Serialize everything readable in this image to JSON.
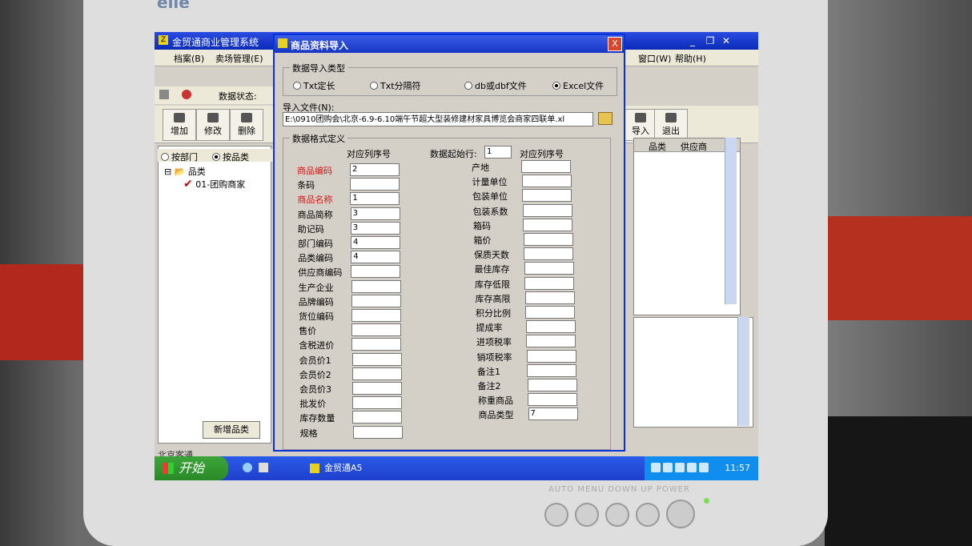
{
  "brand": "elle",
  "app": {
    "title": "金贸通商业管理系统",
    "menu": [
      "档案(B)",
      "卖场管理(E)",
      "窗口(W)",
      "帮助(H)"
    ],
    "status_label": "数据状态:",
    "toolbar": {
      "add": "增加",
      "edit": "修改",
      "delete": "删除",
      "import": "导入",
      "exit": "退出"
    },
    "filter": {
      "by_dept": "按部门",
      "by_category": "按品类"
    },
    "tree": {
      "root": "品类",
      "child": "01-团购商家"
    },
    "new_category_button": "新增品类",
    "grid_headers": [
      "品类",
      "供应商"
    ],
    "bottom_text": "北京客通"
  },
  "dialog": {
    "title": "商品资料导入",
    "close": "X",
    "type_group_title": "数据导入类型",
    "types": [
      {
        "label": "Txt定长",
        "selected": false
      },
      {
        "label": "Txt分隔符",
        "selected": false
      },
      {
        "label": "db或dbf文件",
        "selected": false
      },
      {
        "label": "Excel文件",
        "selected": true
      }
    ],
    "file_label": "导入文件(N):",
    "file_path": "E:\\0910团购会\\北京-6.9-6.10端午节超大型装修建材家具博览会商家四联单.xl",
    "format_group_title": "数据格式定义",
    "col_header_left": "对应列序号",
    "col_header_right": "对应列序号",
    "start_row_label": "数据起始行:",
    "start_row_value": "1",
    "left_fields": [
      {
        "label": "商品编码",
        "value": "2",
        "required": true
      },
      {
        "label": "条码",
        "value": "",
        "required": false
      },
      {
        "label": "商品名称",
        "value": "1",
        "required": true
      },
      {
        "label": "商品简称",
        "value": "3",
        "required": false
      },
      {
        "label": "助记码",
        "value": "3",
        "required": false
      },
      {
        "label": "部门编码",
        "value": "4",
        "required": false
      },
      {
        "label": "品类编码",
        "value": "4",
        "required": false
      },
      {
        "label": "供应商编码",
        "value": "",
        "required": false
      },
      {
        "label": "生产企业",
        "value": "",
        "required": false
      },
      {
        "label": "品牌编码",
        "value": "",
        "required": false
      },
      {
        "label": "货位编码",
        "value": "",
        "required": false
      },
      {
        "label": "售价",
        "value": "",
        "required": false
      },
      {
        "label": "含税进价",
        "value": "",
        "required": false
      },
      {
        "label": "会员价1",
        "value": "",
        "required": false
      },
      {
        "label": "会员价2",
        "value": "",
        "required": false
      },
      {
        "label": "会员价3",
        "value": "",
        "required": false
      },
      {
        "label": "批发价",
        "value": "",
        "required": false
      },
      {
        "label": "库存数量",
        "value": "",
        "required": false
      },
      {
        "label": "规格",
        "value": "",
        "required": false
      }
    ],
    "right_fields": [
      {
        "label": "产地",
        "value": ""
      },
      {
        "label": "计量单位",
        "value": ""
      },
      {
        "label": "包装单位",
        "value": ""
      },
      {
        "label": "包装系数",
        "value": ""
      },
      {
        "label": "箱码",
        "value": ""
      },
      {
        "label": "箱价",
        "value": ""
      },
      {
        "label": "保质天数",
        "value": ""
      },
      {
        "label": "最佳库存",
        "value": ""
      },
      {
        "label": "库存低限",
        "value": ""
      },
      {
        "label": "库存高限",
        "value": ""
      },
      {
        "label": "积分比例",
        "value": ""
      },
      {
        "label": "提成率",
        "value": ""
      },
      {
        "label": "进项税率",
        "value": ""
      },
      {
        "label": "销项税率",
        "value": ""
      },
      {
        "label": "备注1",
        "value": ""
      },
      {
        "label": "备注2",
        "value": ""
      },
      {
        "label": "称重商品",
        "value": ""
      },
      {
        "label": "商品类型",
        "value": "7"
      }
    ]
  },
  "taskbar": {
    "start": "开始",
    "task": "金贸通A5",
    "clock": "11:57"
  },
  "monitor_buttons": "AUTO MENU DOWN UP POWER"
}
